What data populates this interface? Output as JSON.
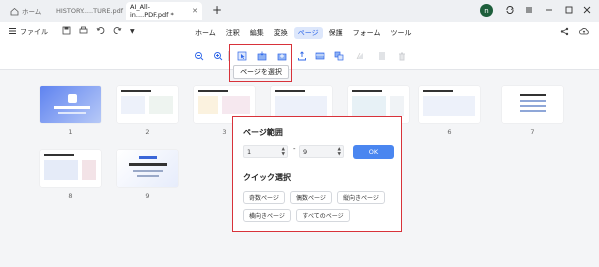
{
  "tabs": [
    {
      "label": "ホーム"
    },
    {
      "label": "HISTORY.....TURE.pdf"
    },
    {
      "label": "AI_All-in....PDF.pdf *"
    }
  ],
  "add_tab": "+",
  "avatar_letter": "n",
  "menubar": {
    "file_label": "ファイル",
    "items": [
      "ホーム",
      "注釈",
      "編集",
      "変換",
      "ページ",
      "保護",
      "フォーム",
      "ツール"
    ],
    "active_item": "ページ"
  },
  "tooltip": "ページを選択",
  "thumbnails": [
    {
      "label": "1"
    },
    {
      "label": "2"
    },
    {
      "label": "3"
    },
    {
      "label": "4"
    },
    {
      "label": "5"
    },
    {
      "label": "6"
    },
    {
      "label": "7"
    },
    {
      "label": "8"
    },
    {
      "label": "9"
    }
  ],
  "page_range_popup": {
    "title": "ページ範囲",
    "from_value": "1",
    "to_value": "9",
    "dash": "-",
    "ok_label": "OK",
    "quick_title": "クイック選択",
    "quick_buttons": [
      "奇数ページ",
      "偶数ページ",
      "縦向きページ",
      "横向きページ",
      "すべてのページ"
    ]
  },
  "colors": {
    "accent": "#2f67e8",
    "ok_button": "#4a86f0",
    "highlight_border": "#d8323a",
    "avatar": "#1d5e3b"
  }
}
